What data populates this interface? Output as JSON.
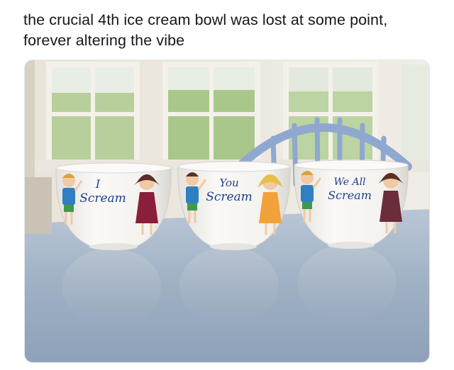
{
  "post": {
    "caption_line1": "the crucial 4th ice cream bowl was lost at some point,",
    "caption_line2": "forever altering the vibe"
  },
  "photo": {
    "bowls": [
      {
        "text_line1": "I",
        "text_line2": "Scream"
      },
      {
        "text_line1": "You",
        "text_line2": "Scream"
      },
      {
        "text_line1": "We All",
        "text_line2": "Scream"
      }
    ],
    "colors": {
      "table": "#a9b9cc",
      "bowl": "#f5f4f1",
      "chair": "#8fa8d0",
      "lettering": "#1f3f8f",
      "foliage": "#a9c78a"
    }
  }
}
